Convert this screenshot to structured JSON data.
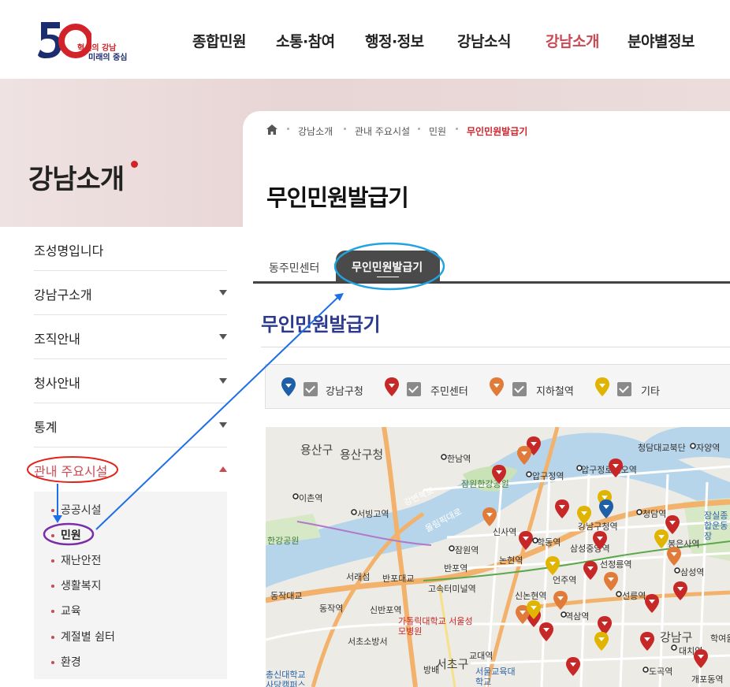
{
  "logo": {
    "number": "50",
    "line1": "혁신의 강남",
    "line2": "미래의 중심"
  },
  "gnb": [
    "종합민원",
    "소통·참여",
    "행정·정보",
    "강남소식",
    "강남소개",
    "분야별정보"
  ],
  "gnb_active_index": 4,
  "section_title": "강남소개",
  "breadcrumb": [
    "강남소개",
    "관내 주요시설",
    "민원",
    "무인민원발급기"
  ],
  "page_title": "무인민원발급기",
  "lnb": {
    "items": [
      "조성명입니다",
      "강남구소개",
      "조직안내",
      "청사안내",
      "통계",
      "관내 주요시설"
    ],
    "sub_items": [
      "공공시설",
      "민원",
      "재난안전",
      "생활복지",
      "교육",
      "계절별 쉼터",
      "환경"
    ]
  },
  "tabs": [
    "동주민센터",
    "무인민원발급기"
  ],
  "content_heading": "무인민원발급기",
  "legend": [
    {
      "label": "강남구청",
      "color": "#1f5fa8"
    },
    {
      "label": "주민센터",
      "color": "#c62828"
    },
    {
      "label": "지하철역",
      "color": "#e07b39"
    },
    {
      "label": "기타",
      "color": "#e0b400"
    }
  ],
  "map": {
    "labels": [
      "용산구",
      "용산구청",
      "한남역",
      "압구정역",
      "압구정로데오역",
      "청담역",
      "강남구청역",
      "학동역",
      "신사역",
      "논현역",
      "선정릉역",
      "선릉역",
      "신논현역",
      "언주역",
      "역삼역",
      "강남구",
      "대치역",
      "도곡역",
      "교대역",
      "고속터미널역",
      "반포역",
      "서초구",
      "서초소방서",
      "가톨릭대학교 서울성모병원",
      "동작역",
      "이촌역",
      "서빙고역",
      "한강공원",
      "잠원역",
      "잠원한강공원",
      "동작대교",
      "서울교육대학교",
      "총신대학교 사당캠퍼스",
      "청담대교북단",
      "자양역",
      "삼성역",
      "봉은사역",
      "강변북로",
      "올림픽대로",
      "서래섬",
      "반포대교",
      "신반포역",
      "방배",
      "잠실종합운동장",
      "개포동역",
      "학여울역",
      "삼성중앙역",
      "선정릉역"
    ],
    "marker_counts": {
      "강남구청": 1,
      "주민센터": 24,
      "지하철역": 7,
      "기타": 5
    }
  }
}
